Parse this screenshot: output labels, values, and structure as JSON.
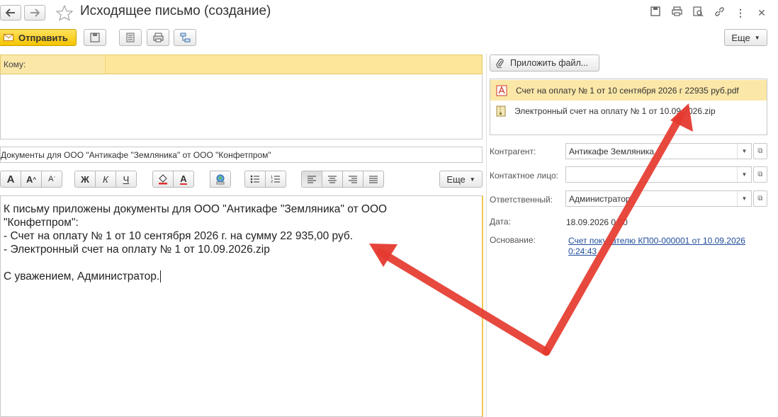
{
  "window": {
    "title": "Исходящее письмо (создание)"
  },
  "toolbar": {
    "send_label": "Отправить",
    "more_label": "Еще"
  },
  "recipients": {
    "to_label": "Кому:"
  },
  "subject": {
    "value": "Документы для ООО \"Антикафе \"Земляника\" от ООО \"Конфетпром\""
  },
  "format_toolbar": {
    "bold": "Ж",
    "italic": "К",
    "underline": "Ч",
    "font_big": "A",
    "font_up": "A",
    "font_down": "A",
    "font_color": "A",
    "more_label": "Еще"
  },
  "body": {
    "lines": [
      "К письму приложены документы для ООО \"Антикафе \"Земляника\" от ООО",
      "\"Конфетпром\":",
      "- Счет на оплату № 1 от 10 сентября 2026 г. на сумму 22 935,00 руб.",
      "- Электронный счет на оплату № 1 от 10.09.2026.zip",
      "",
      "",
      "С уважением, Администратор."
    ]
  },
  "attachments": {
    "attach_button": "Приложить файл...",
    "files": [
      {
        "name": "Счет на оплату № 1 от 10 сентября 2026 г 22935 руб.pdf",
        "icon": "pdf-icon"
      },
      {
        "name": "Электронный счет на оплату № 1 от 10.09.2026.zip",
        "icon": "zip-icon"
      }
    ]
  },
  "details": {
    "counterparty_label": "Контрагент:",
    "counterparty_value": "Антикафе Земляника",
    "contact_label": "Контактное лицо:",
    "contact_value": "",
    "responsible_label": "Ответственный:",
    "responsible_value": "Администратор",
    "date_label": "Дата:",
    "date_value": "18.09.2026 0:00",
    "basis_label": "Основание:",
    "basis_link": "Счет покупателю КП00-000001 от 10.09.2026 0:24:43"
  },
  "colors": {
    "highlight": "#fde599",
    "send_button": "#f5c400",
    "link": "#1f4c9c",
    "annotation_arrow": "#e53a2f"
  }
}
